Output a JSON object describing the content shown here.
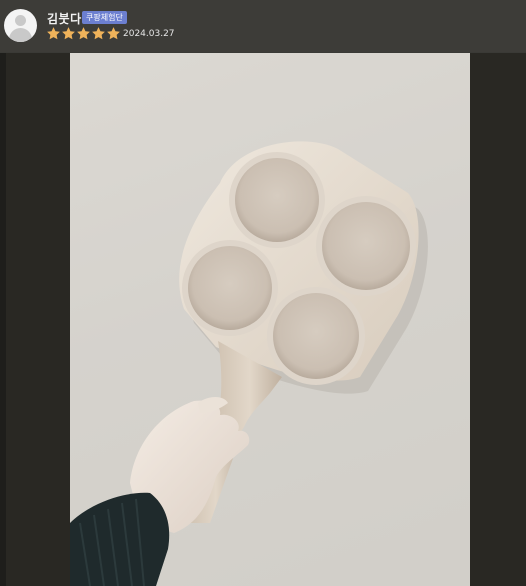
{
  "review": {
    "username": "김붓다",
    "badge": "쿠팡체험단",
    "rating": 5,
    "rating_max": 5,
    "date": "2024.03.27",
    "star_color": "#f0b35a"
  },
  "photo": {
    "subject": "product-photo-pan"
  },
  "colors": {
    "header_bg": "#3d3c38",
    "badge_bg": "#6c7fd0",
    "photo_bg": "#292823"
  }
}
